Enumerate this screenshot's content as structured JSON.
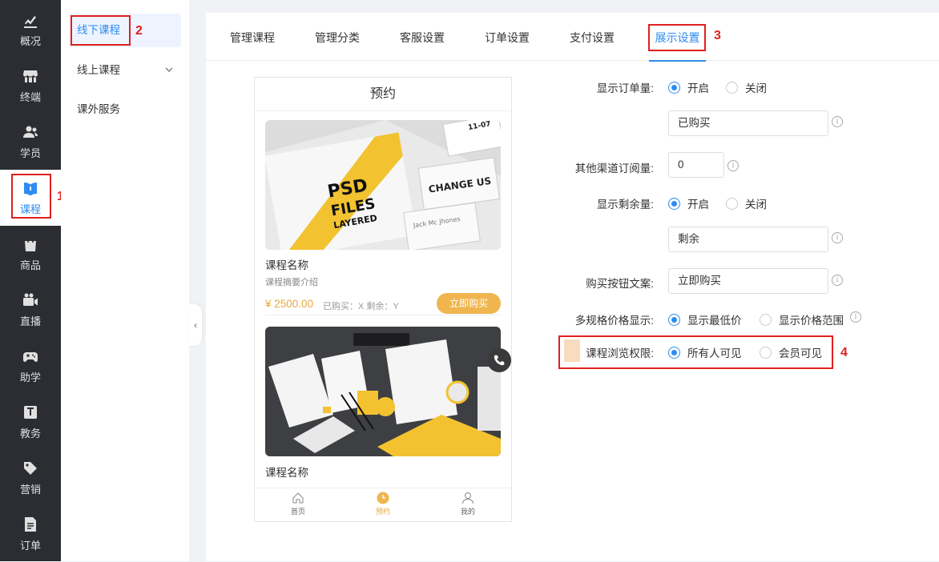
{
  "sidebar": {
    "items": [
      {
        "label": "概况",
        "icon": "chart-icon"
      },
      {
        "label": "终端",
        "icon": "store-icon"
      },
      {
        "label": "学员",
        "icon": "users-icon"
      },
      {
        "label": "课程",
        "icon": "book-icon",
        "active": true
      },
      {
        "label": "商品",
        "icon": "bag-icon"
      },
      {
        "label": "直播",
        "icon": "video-icon"
      },
      {
        "label": "助学",
        "icon": "gamepad-icon"
      },
      {
        "label": "教务",
        "icon": "board-icon"
      },
      {
        "label": "营销",
        "icon": "tag-icon"
      },
      {
        "label": "订单",
        "icon": "document-icon"
      }
    ]
  },
  "subnav": {
    "items": [
      {
        "label": "线下课程"
      },
      {
        "label": "线上课程"
      },
      {
        "label": "课外服务"
      }
    ]
  },
  "tabs": [
    {
      "label": "管理课程"
    },
    {
      "label": "管理分类"
    },
    {
      "label": "客服设置"
    },
    {
      "label": "订单设置"
    },
    {
      "label": "支付设置"
    },
    {
      "label": "展示设置"
    }
  ],
  "annotations": [
    "1",
    "2",
    "3",
    "4"
  ],
  "phone": {
    "title": "预约",
    "card1": {
      "name": "课程名称",
      "desc": "课程摘要介绍",
      "price": "¥ 2500.00",
      "sold": "已购买：X  剩余：Y",
      "buy_label": "立即购买",
      "image_text": {
        "line1": "PSD",
        "line2": "FILES",
        "line3": "LAYERED",
        "card": "CHANGE US",
        "name": "Jack Mc Jhones",
        "corner": "11-07"
      }
    },
    "card2": {
      "name": "课程名称"
    },
    "bottom_nav": [
      {
        "label": "首页",
        "icon": "home-icon"
      },
      {
        "label": "预约",
        "icon": "clock-icon",
        "active": true
      },
      {
        "label": "我的",
        "icon": "user-icon"
      }
    ]
  },
  "settings": {
    "show_orders": {
      "label": "显示订单量:",
      "opt_on": "开启",
      "opt_off": "关闭",
      "selected": "on",
      "text_value": "已购买"
    },
    "other_channel": {
      "label": "其他渠道订阅量:",
      "value": "0"
    },
    "show_remaining": {
      "label": "显示剩余量:",
      "opt_on": "开启",
      "opt_off": "关闭",
      "selected": "on",
      "text_value": "剩余"
    },
    "buy_button_text": {
      "label": "购买按钮文案:",
      "value": "立即购买"
    },
    "multi_spec_price": {
      "label": "多规格价格显示:",
      "opt_min": "显示最低价",
      "opt_range": "显示价格范围",
      "selected": "min"
    },
    "browse_permission": {
      "label": "课程浏览权限:",
      "opt_all": "所有人可见",
      "opt_member": "会员可见",
      "selected": "all"
    }
  },
  "colors": {
    "accent": "#2d8cf0",
    "sidebar_bg": "#2b2d33",
    "annotation_red": "#e02020",
    "price": "#e8a93b"
  }
}
